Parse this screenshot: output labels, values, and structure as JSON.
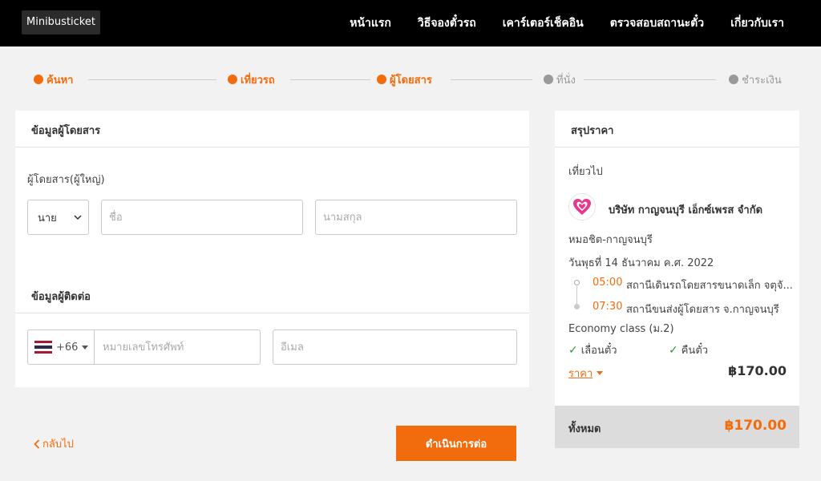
{
  "header": {
    "logo_text": "Minibusticket",
    "nav": [
      "หน้าแรก",
      "วิธีจองตั๋วรถ",
      "เคาร์เตอร์เช็คอิน",
      "ตรวจสอบสถานะตั๋ว",
      "เกี่ยวกับเรา"
    ]
  },
  "steps": [
    {
      "label": "ค้นหา",
      "state": "active"
    },
    {
      "label": "เที่ยวรถ",
      "state": "active"
    },
    {
      "label": "ผู้โดยสาร",
      "state": "active"
    },
    {
      "label": "ที่นั่ง",
      "state": "inactive"
    },
    {
      "label": "ชำระเงิน",
      "state": "inactive"
    }
  ],
  "passenger": {
    "section_title": "ข้อมูลผู้โดยสาร",
    "passenger_type": "ผู้โดยสาร(ผู้ใหญ่)",
    "title_select": "นาย",
    "first_name_placeholder": "ชื่อ",
    "last_name_placeholder": "นามสกุล"
  },
  "contact": {
    "section_title": "ข้อมูลผู้ติดต่อ",
    "country_code": "+66",
    "phone_placeholder": "หมายเลขโทรศัพท์",
    "email_placeholder": "อีเมล"
  },
  "summary": {
    "title": "สรุปราคา",
    "direction": "เที่ยวไป",
    "operator": "บริษัท กาญจนบุรี เอ็กซ์เพรส จำกัด",
    "route": "หมอชิต-กาญจนบุรี",
    "date": "วันพุธที่ 14 ธันวาคม ค.ศ. 2022",
    "depart_time": "05:00",
    "depart_station": "สถานีเดินรถโดยสารขนาดเล็ก จตุจั...",
    "arrive_time": "07:30",
    "arrive_station": "สถานีขนส่งผู้โดยสาร จ.กาญจนบุรี",
    "class": "Economy class (ม.2)",
    "refundable": "เลื่อนตั๋ว",
    "exchangeable": "คืนตั๋ว",
    "price_label": "ราคา",
    "price": "฿170.00",
    "total_label": "ทั้งหมด",
    "total": "฿170.00"
  },
  "actions": {
    "back": "กลับไป",
    "continue": "ดำเนินการต่อ"
  },
  "colors": {
    "accent": "#f26c0d",
    "header_bg": "#000000",
    "inactive_step": "#999999",
    "check": "#2e9b2e"
  }
}
